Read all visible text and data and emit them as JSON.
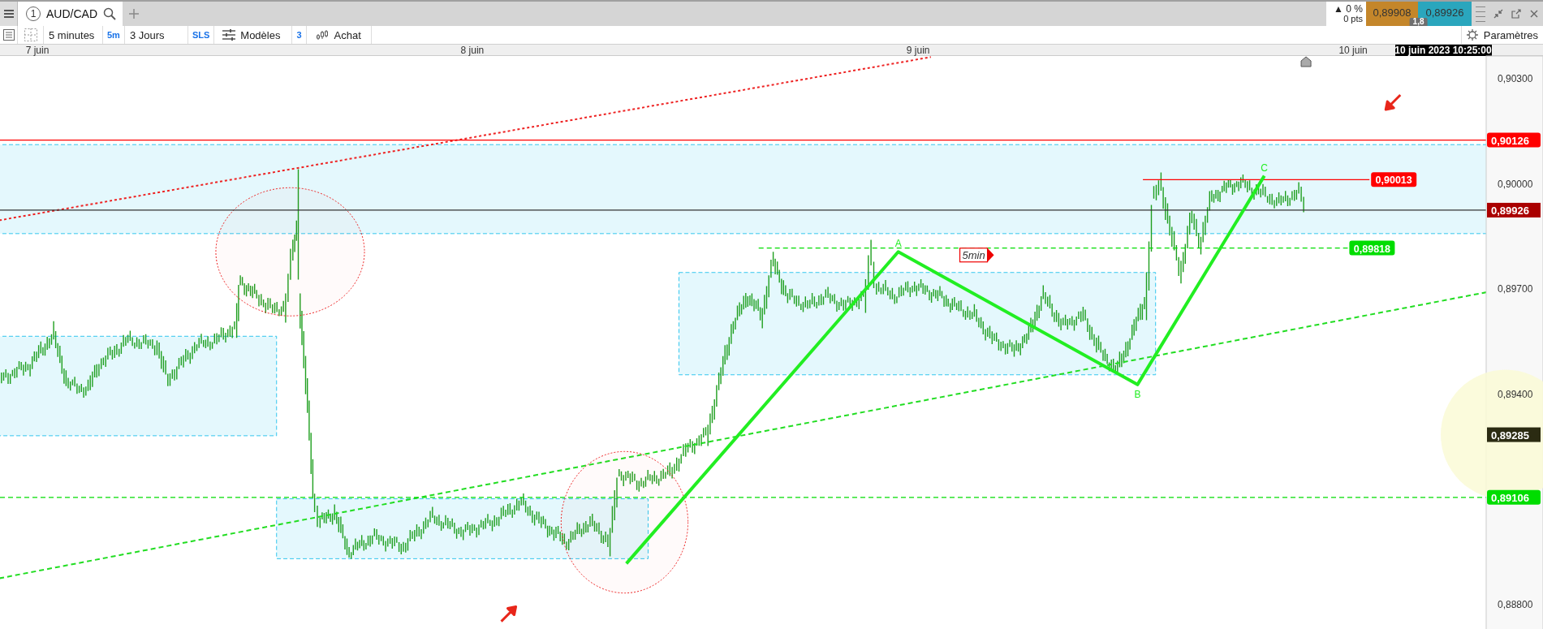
{
  "tab_bar": {
    "tabs": [
      {
        "number": "1",
        "label": "AUD/CAD",
        "selected": true
      }
    ],
    "quote": {
      "change": "▲ 0 %",
      "points": "0 pts",
      "bid": "0,89908",
      "ask": "0,89926",
      "spread": "1,8"
    }
  },
  "toolbar": {
    "items": [
      {
        "kind": "text",
        "label": "5 minutes"
      },
      {
        "kind": "tag",
        "label": "5m"
      },
      {
        "kind": "text",
        "label": "3 Jours"
      },
      {
        "kind": "tag",
        "label": "SLS"
      },
      {
        "kind": "templates",
        "label": "Modèles"
      },
      {
        "kind": "tag",
        "label": "3"
      },
      {
        "kind": "trade",
        "label": "Achat"
      }
    ],
    "settings": "Paramètres"
  },
  "chart": {
    "time_labels": [
      "7 juin",
      "8 juin",
      "9 juin",
      "10 juin"
    ],
    "cursor_time": "10 juin 2023 10:25:00",
    "price_ticks": [
      "0,90300",
      "0,90000",
      "0,89700",
      "0,89400",
      "0,88800"
    ],
    "level_labels": [
      {
        "kind": "axis",
        "label": "0,90126",
        "color": "#ff0000"
      },
      {
        "kind": "line-end",
        "label": "0,90013",
        "color": "#ff0000"
      },
      {
        "kind": "axis",
        "label": "0,89926",
        "color": "#aa0000"
      },
      {
        "kind": "line-end",
        "label": "0,89818",
        "color": "#00dd00"
      },
      {
        "kind": "cursor",
        "label": "0,89285",
        "color": "#2b2b12"
      },
      {
        "kind": "axis",
        "label": "0,89106",
        "color": "#00dd00"
      }
    ],
    "wave_labels": [
      "A",
      "B",
      "C"
    ],
    "flag_label": "5min"
  }
}
